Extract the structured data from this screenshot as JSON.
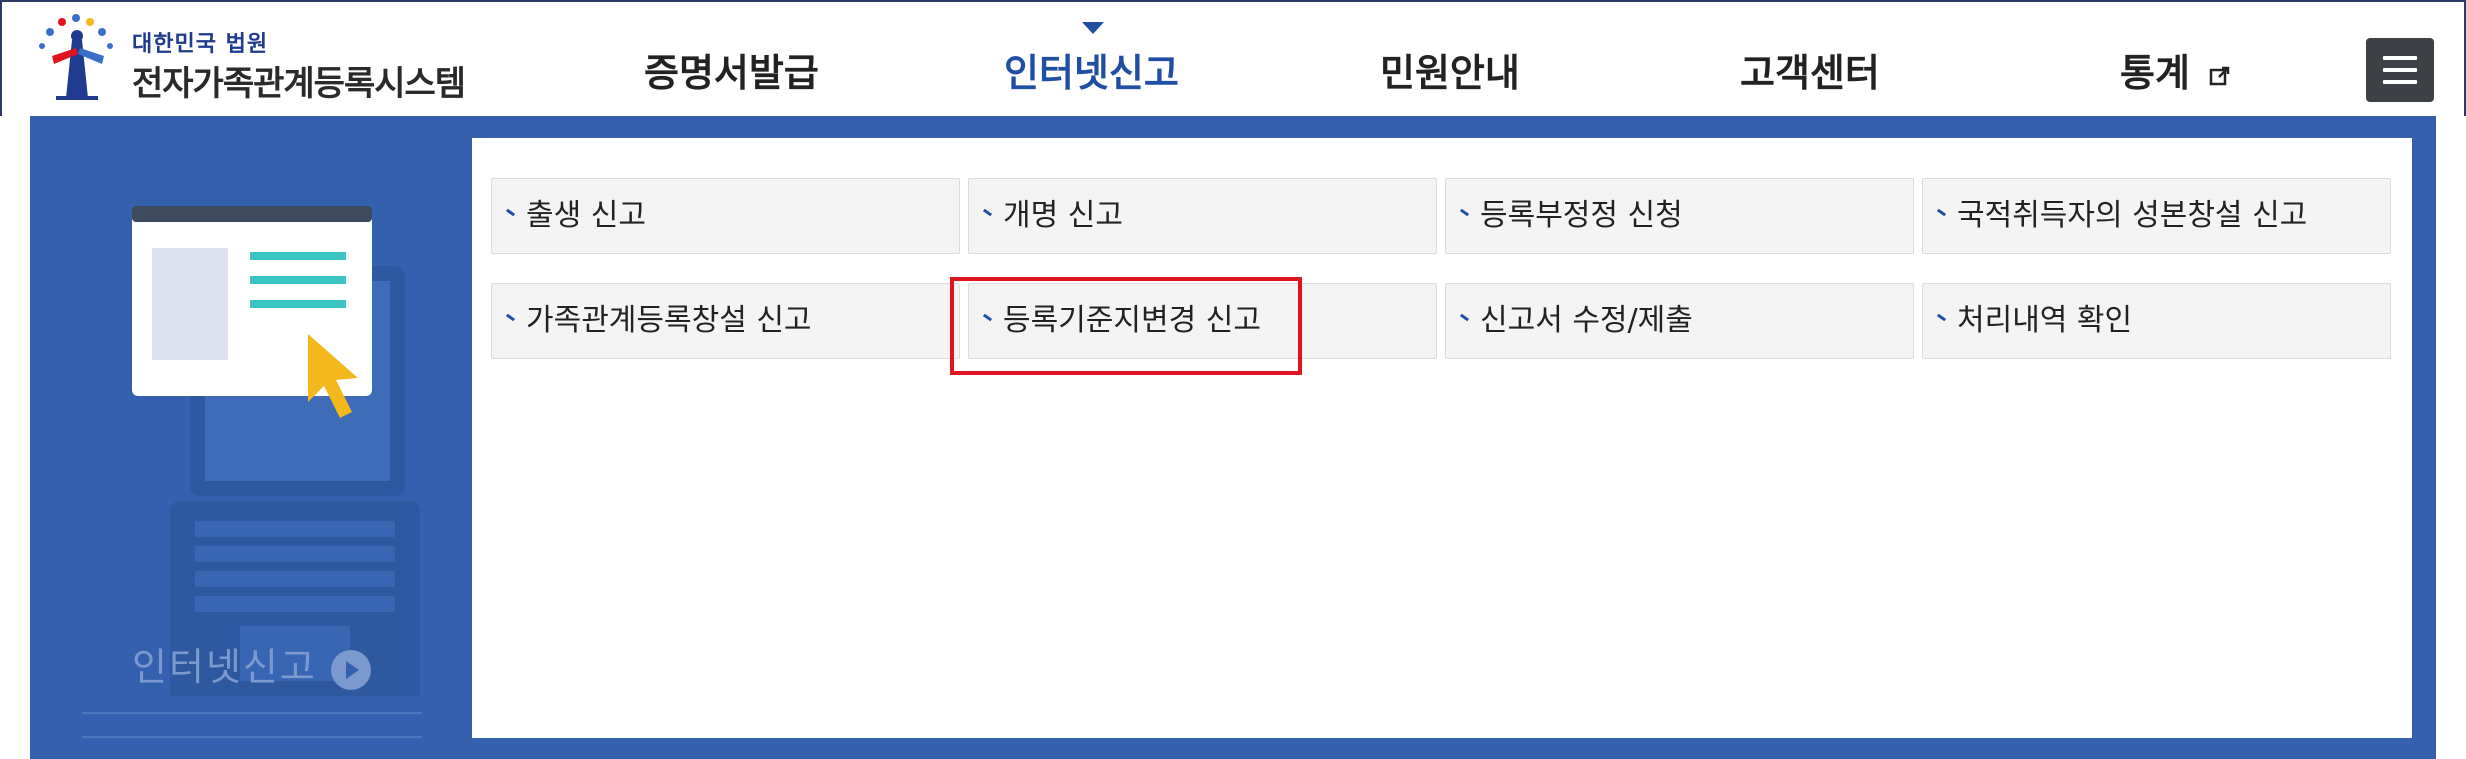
{
  "header": {
    "logo_sub": "대한민국 법원",
    "logo_main": "전자가족관계등록시스템",
    "nav": [
      {
        "label": "증명서발급",
        "active": false
      },
      {
        "label": "인터넷신고",
        "active": true
      },
      {
        "label": "민원안내",
        "active": false
      },
      {
        "label": "고객센터",
        "active": false
      },
      {
        "label": "통계",
        "active": false,
        "external": true
      }
    ],
    "menu_icon": "hamburger-icon"
  },
  "panel": {
    "caption": "인터넷신고",
    "illustration_icon": "laptop-document-cursor-illustration",
    "links": [
      {
        "label": "출생 신고"
      },
      {
        "label": "개명 신고"
      },
      {
        "label": "등록부정정 신청"
      },
      {
        "label": "국적취득자의 성본창설 신고"
      },
      {
        "label": "가족관계등록창설 신고"
      },
      {
        "label": "등록기준지변경 신고"
      },
      {
        "label": "신고서 수정/제출"
      },
      {
        "label": "처리내역 확인"
      }
    ]
  },
  "colors": {
    "brand_blue": "#1f4fa3",
    "panel_blue": "#3460ae",
    "highlight_red": "#e0141e",
    "accent_yellow": "#f5b81c",
    "accent_teal": "#3cc3c3"
  }
}
